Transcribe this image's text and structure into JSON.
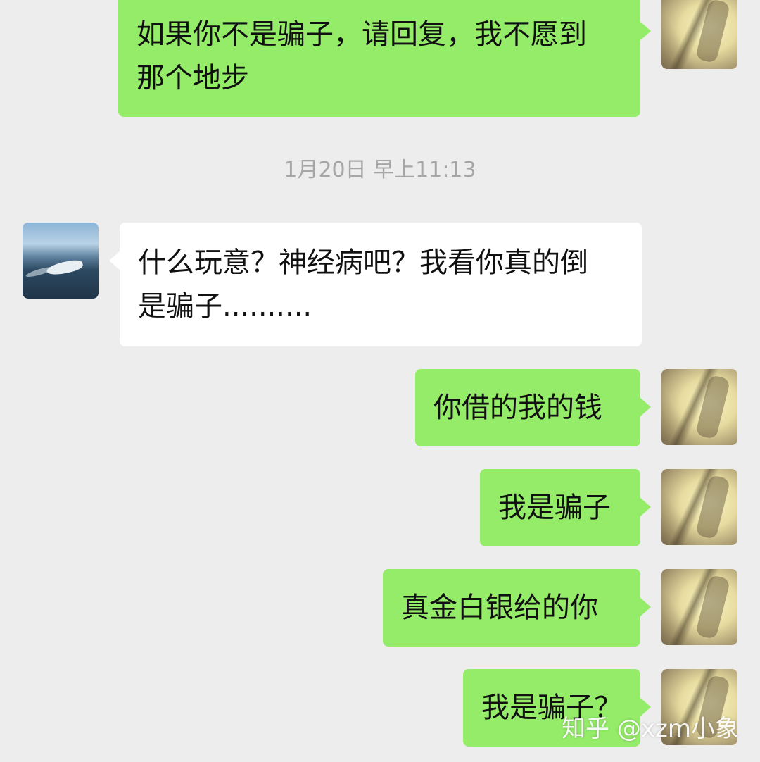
{
  "messages": [
    {
      "side": "sent",
      "text": "如果你不是骗子，请回复，我不愿到\n那个地步"
    },
    {
      "side": "recv",
      "text": "什么玩意？神经病吧？我看你真的倒\n是骗子.........."
    },
    {
      "side": "sent",
      "text": "你借的我的钱"
    },
    {
      "side": "sent",
      "text": "我是骗子"
    },
    {
      "side": "sent",
      "text": "真金白银给的你"
    },
    {
      "side": "sent",
      "text": "我是骗子？"
    }
  ],
  "timestamp": "1月20日 早上11:13",
  "watermark": "知乎 @xzm小象",
  "colors": {
    "background": "#ededed",
    "sent_bubble": "#95ec69",
    "received_bubble": "#ffffff",
    "timestamp_text": "#a6a6a6",
    "message_text": "#111111"
  }
}
